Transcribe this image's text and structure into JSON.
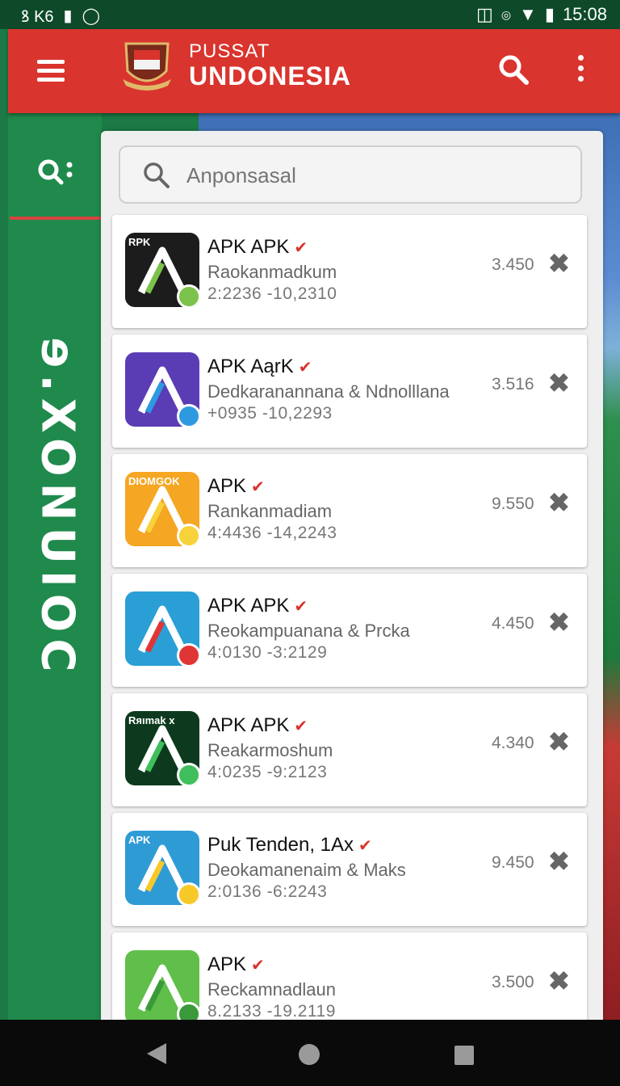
{
  "status_bar": {
    "left_text": "ꝸ K6",
    "time": "15:08"
  },
  "app_bar": {
    "title_line1": "PUSSAT",
    "title_line2": "UNDONESIA"
  },
  "sidebar": {
    "vertical_text": "ɘ.XONUIOC"
  },
  "search": {
    "placeholder": "Anponsasal"
  },
  "apps": [
    {
      "name": "APK APK",
      "description": "Raokanmadkum",
      "dates": "2:2236 -10,2310",
      "rating": "3.450",
      "icon_tag": "RPK",
      "icon_bg": "#1c1c1c",
      "accent": "#7bc24a"
    },
    {
      "name": "APK AąrK",
      "description": "Dedkaranannana & Ndnolllana",
      "dates": "+0935 -10,2293",
      "rating": "3.516",
      "icon_tag": "",
      "icon_bg": "#5a3db5",
      "accent": "#2d9ae0"
    },
    {
      "name": "APK",
      "description": "Rankanmadiam",
      "dates": "4:4436 -14,2243",
      "rating": "9.550",
      "icon_tag": "DIOMGOK",
      "icon_bg": "#f5a623",
      "accent": "#f7d23a"
    },
    {
      "name": "APK APK",
      "description": "Reokampuanana & Prcka",
      "dates": "4:0130 -3:2129",
      "rating": "4.450",
      "icon_tag": "",
      "icon_bg": "#2a9fd6",
      "accent": "#e03535"
    },
    {
      "name": "APK APK",
      "description": "Reakarmoshum",
      "dates": "4:0235 -9:2123",
      "rating": "4.340",
      "icon_tag": "Rяımak x",
      "icon_bg": "#0d3a1e",
      "accent": "#3fbf5c"
    },
    {
      "name": "Puk Tenden, 1Ax",
      "description": "Deokamanenaim & Maks",
      "dates": "2:0136 -6:2243",
      "rating": "9.450",
      "icon_tag": "APK",
      "icon_bg": "#2f9bd5",
      "accent": "#f7c928"
    },
    {
      "name": "APK",
      "description": "Reckamnadlaun",
      "dates": "8.2133 -19.2119",
      "rating": "3.500",
      "icon_tag": "",
      "icon_bg": "#5fbf4a",
      "accent": "#3a9a3a"
    }
  ]
}
